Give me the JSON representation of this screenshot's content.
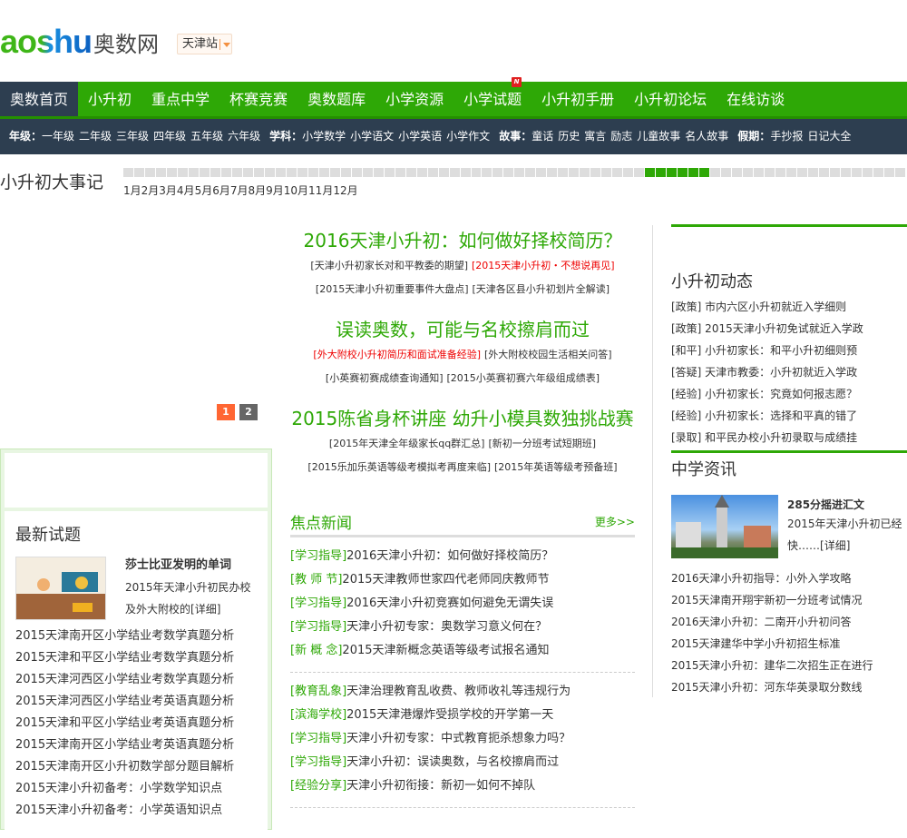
{
  "header": {
    "logo_en": "aoshu",
    "logo_cn": "奥数网",
    "city": "天津站"
  },
  "nav": {
    "items": [
      "奥数首页",
      "小升初",
      "重点中学",
      "杯赛竞赛",
      "奥数题库",
      "小学资源",
      "小学试题",
      "小升初手册",
      "小升初论坛",
      "在线访谈"
    ],
    "badge": "N"
  },
  "subnav": {
    "grade_label": "年级：",
    "grades": [
      "一年级",
      "二年级",
      "三年级",
      "四年级",
      "五年级",
      "六年级"
    ],
    "subject_label": "学科：",
    "subjects": [
      "小学数学",
      "小学语文",
      "小学英语",
      "小学作文"
    ],
    "story_label": "故事：",
    "stories": [
      "童话",
      "历史",
      "寓言",
      "励志",
      "儿童故事",
      "名人故事"
    ],
    "holiday_label": "假期：",
    "holidays": [
      "手抄报",
      "日记大全"
    ]
  },
  "timeline": {
    "title": "小升初大事记",
    "months": [
      "1月",
      "2月",
      "3月",
      "4月",
      "5月",
      "6月",
      "7月",
      "8月",
      "9月",
      "10月",
      "11月",
      "12月"
    ],
    "active_month": "9月",
    "accent": "#2ea806"
  },
  "carousel": {
    "pages": [
      "1",
      "2"
    ],
    "active": "1"
  },
  "latest_tests": {
    "title": "最新试题",
    "feature": {
      "title": "莎士比亚发明的单词",
      "desc": "2015年天津小升初民办校及外大附校的",
      "more": "[详细]"
    },
    "items": [
      "2015天津南开区小学结业考数学真题分析",
      "2015天津和平区小学结业考数学真题分析",
      "2015天津河西区小学结业考数学真题分析",
      "2015天津河西区小学结业考英语真题分析",
      "2015天津和平区小学结业考英语真题分析",
      "2015天津南开区小学结业考英语真题分析",
      "2015天津南开区小升初数学部分题目解析",
      "2015天津小升初备考：小学数学知识点",
      "2015天津小升初备考：小学英语知识点"
    ]
  },
  "headlines": [
    {
      "title": "2016天津小升初：如何做好择校简历？",
      "links": [
        [
          "[天津小升初家长对和平教委的期望]",
          "[2015天津小升初・不想说再见]"
        ],
        [
          "[2015天津小升初重要事件大盘点]",
          "[天津各区县小升初划片全解读]"
        ]
      ],
      "red": [
        "[2015天津小升初・不想说再见]"
      ]
    },
    {
      "title": "误读奥数，可能与名校擦肩而过",
      "links": [
        [
          "[外大附校小升初简历和面试准备经验]",
          "[外大附校校园生活相关问答]"
        ],
        [
          "[小英赛初赛成绩查询通知]",
          "[2015小英赛初赛六年级组成绩表]"
        ]
      ],
      "red": [
        "[外大附校小升初简历和面试准备经验]"
      ]
    },
    {
      "title": "2015陈省身杯讲座 幼升小模具数独挑战赛",
      "links": [
        [
          "[2015年天津全年级家长qq群汇总]",
          "[新初一分班考试短期班]"
        ],
        [
          "[2015乐加乐英语等级考模拟考再度来临]",
          "[2015年英语等级考预备班]"
        ]
      ],
      "red": []
    }
  ],
  "focus": {
    "title": "焦点新闻",
    "more": "更多>>",
    "group1": [
      [
        "[学习指导]",
        "2016天津小升初：如何做好择校简历？"
      ],
      [
        "[教 师 节]",
        "2015天津教师世家四代老师同庆教师节"
      ],
      [
        "[学习指导]",
        "2016天津小升初竞赛如何避免无谓失误"
      ],
      [
        "[学习指导]",
        "天津小升初专家：奥数学习意义何在？"
      ],
      [
        "[新 概 念]",
        "2015天津新概念英语等级考试报名通知"
      ]
    ],
    "group2": [
      [
        "[教育乱象]",
        "天津治理教育乱收费、教师收礼等违规行为"
      ],
      [
        "[滨海学校]",
        "2015天津港爆炸受损学校的开学第一天"
      ],
      [
        "[学习指导]",
        "天津小升初专家：中式教育扼杀想象力吗？"
      ],
      [
        "[学习指导]",
        "天津小升初：误读奥数，与名校擦肩而过"
      ],
      [
        "[经验分享]",
        "天津小升初衔接：新初一如何不掉队"
      ]
    ]
  },
  "dynamics": {
    "title": "小升初动态",
    "items": [
      "[政策] 市内六区小升初就近入学细则",
      "[政策] 2015天津小升初免试就近入学政",
      "[和平] 小升初家长：和平小升初细则预",
      "[答疑] 天津市教委：小升初就近入学政",
      "[经验] 小升初家长：究竟如何报志愿？",
      "[经验] 小升初家长：选择和平真的错了",
      "[录取] 和平民办校小升初录取与成绩挂"
    ]
  },
  "middle_school": {
    "title": "中学资讯",
    "feature": {
      "title": "285分摇进汇文",
      "desc": "2015年天津小升初已经快……",
      "more": "[详细]"
    },
    "items": [
      "2016天津小升初指导：小外入学攻略",
      "2015天津南开翔宇新初一分班考试情况",
      "2016天津小升初：二南开小升初问答",
      "2015天津建华中学小升初招生标准",
      "2015天津小升初：建华二次招生正在进行",
      "2015天津小升初：河东华英录取分数线"
    ]
  }
}
